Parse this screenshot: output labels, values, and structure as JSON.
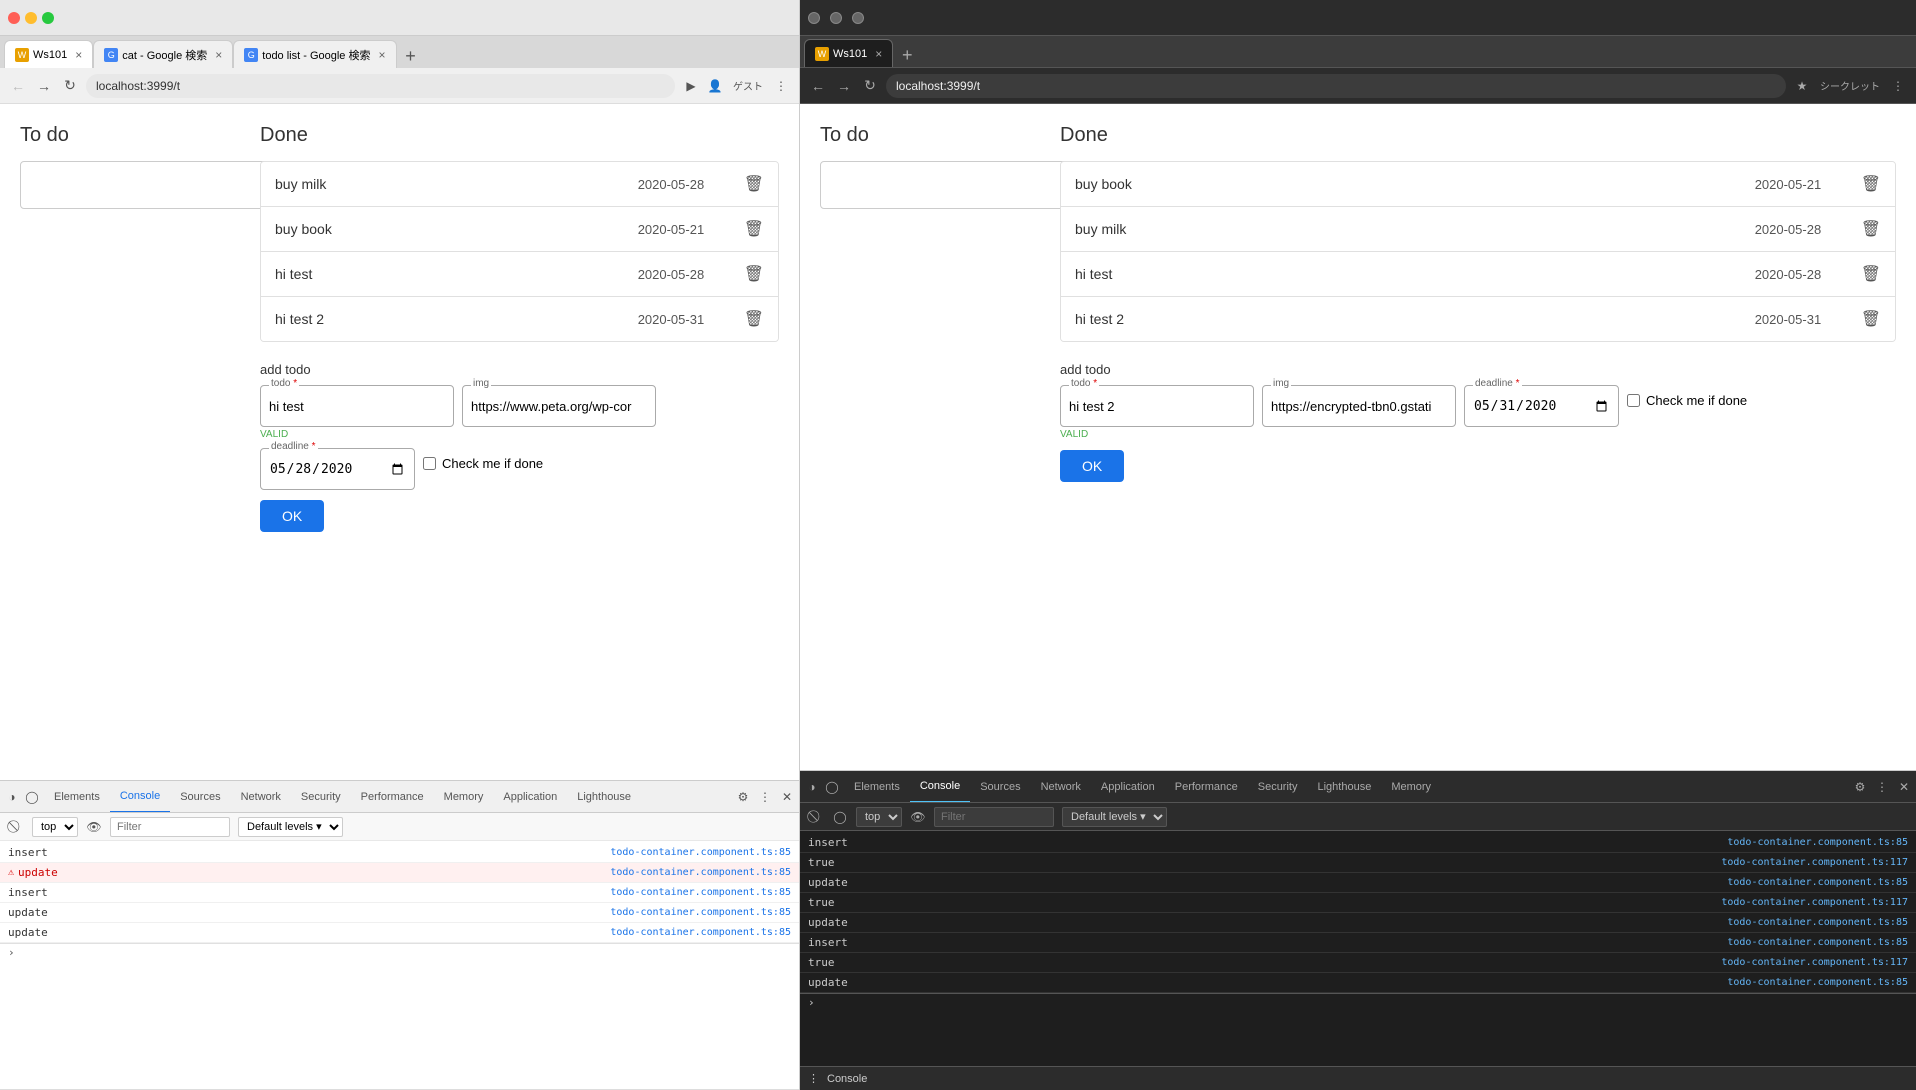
{
  "left_browser": {
    "window_controls": [
      "close",
      "minimize",
      "maximize"
    ],
    "tabs": [
      {
        "id": "ws101",
        "favicon": "W",
        "title": "Ws101",
        "active": true
      },
      {
        "id": "cat",
        "favicon": "G",
        "title": "cat - Google 検索",
        "active": false
      },
      {
        "id": "todo",
        "favicon": "G",
        "title": "todo list - Google 検索",
        "active": false
      }
    ],
    "address": "localhost:3999/t",
    "app": {
      "todo_section_title": "To do",
      "done_section_title": "Done",
      "done_items": [
        {
          "name": "buy milk",
          "date": "2020-05-28"
        },
        {
          "name": "buy book",
          "date": "2020-05-21"
        },
        {
          "name": "hi test",
          "date": "2020-05-28"
        },
        {
          "name": "hi test 2",
          "date": "2020-05-31"
        }
      ],
      "add_todo_label": "add todo",
      "todo_field_label": "todo",
      "img_field_label": "img",
      "deadline_field_label": "deadline",
      "todo_value": "hi test",
      "img_value": "https://www.peta.org/wp-cor",
      "deadline_value": "2020/05/28",
      "valid_text": "VALID",
      "checkbox_label": "Check me if done",
      "ok_button": "OK",
      "required_mark": "*"
    },
    "devtools": {
      "tabs": [
        "Elements",
        "Console",
        "Sources",
        "Network",
        "Security",
        "Performance",
        "Memory",
        "Application",
        "Lighthouse"
      ],
      "active_tab": "Console",
      "context": "top",
      "filter_placeholder": "Filter",
      "levels": "Default levels",
      "console_rows": [
        {
          "text": "insert",
          "source": "todo-container.component.ts:85",
          "type": "normal"
        },
        {
          "text": "update",
          "source": "todo-container.component.ts:85",
          "type": "error"
        },
        {
          "text": "insert",
          "source": "todo-container.component.ts:85",
          "type": "normal"
        },
        {
          "text": "update",
          "source": "todo-container.component.ts:85",
          "type": "normal"
        },
        {
          "text": "update",
          "source": "todo-container.component.ts:85",
          "type": "normal"
        }
      ]
    }
  },
  "right_browser": {
    "window_controls": [
      "close",
      "minimize",
      "maximize"
    ],
    "tab_title": "Ws101",
    "address": "localhost:3999/t",
    "user_label": "シークレット",
    "app": {
      "todo_section_title": "To do",
      "done_section_title": "Done",
      "done_items": [
        {
          "name": "buy book",
          "date": "2020-05-21"
        },
        {
          "name": "buy milk",
          "date": "2020-05-28"
        },
        {
          "name": "hi test",
          "date": "2020-05-28"
        },
        {
          "name": "hi test 2",
          "date": "2020-05-31"
        }
      ],
      "add_todo_label": "add todo",
      "todo_field_label": "todo",
      "img_field_label": "img",
      "deadline_field_label": "deadline",
      "todo_value": "hi test 2",
      "img_value": "https://encrypted-tbn0.gstati",
      "deadline_value": "2020/05/31",
      "valid_text": "VALID",
      "checkbox_label": "Check me if done",
      "ok_button": "OK",
      "required_mark": "*"
    },
    "devtools": {
      "tabs": [
        "Elements",
        "Console",
        "Sources",
        "Network",
        "Application",
        "Performance",
        "Security",
        "Lighthouse",
        "Memory"
      ],
      "active_tab": "Console",
      "context": "top",
      "filter_placeholder": "Filter",
      "levels": "Default levels",
      "console_rows": [
        {
          "text": "insert",
          "source": "todo-container.component.ts:85",
          "type": "normal"
        },
        {
          "text": "true",
          "source": "todo-container.component.ts:117",
          "type": "normal"
        },
        {
          "text": "update",
          "source": "todo-container.component.ts:85",
          "type": "normal"
        },
        {
          "text": "true",
          "source": "todo-container.component.ts:117",
          "type": "normal"
        },
        {
          "text": "update",
          "source": "todo-container.component.ts:85",
          "type": "normal"
        },
        {
          "text": "insert",
          "source": "todo-container.component.ts:85",
          "type": "normal"
        },
        {
          "text": "true",
          "source": "todo-container.component.ts:117",
          "type": "normal"
        },
        {
          "text": "update",
          "source": "todo-container.component.ts:85",
          "type": "normal"
        }
      ],
      "bottom_label": "Console"
    }
  }
}
